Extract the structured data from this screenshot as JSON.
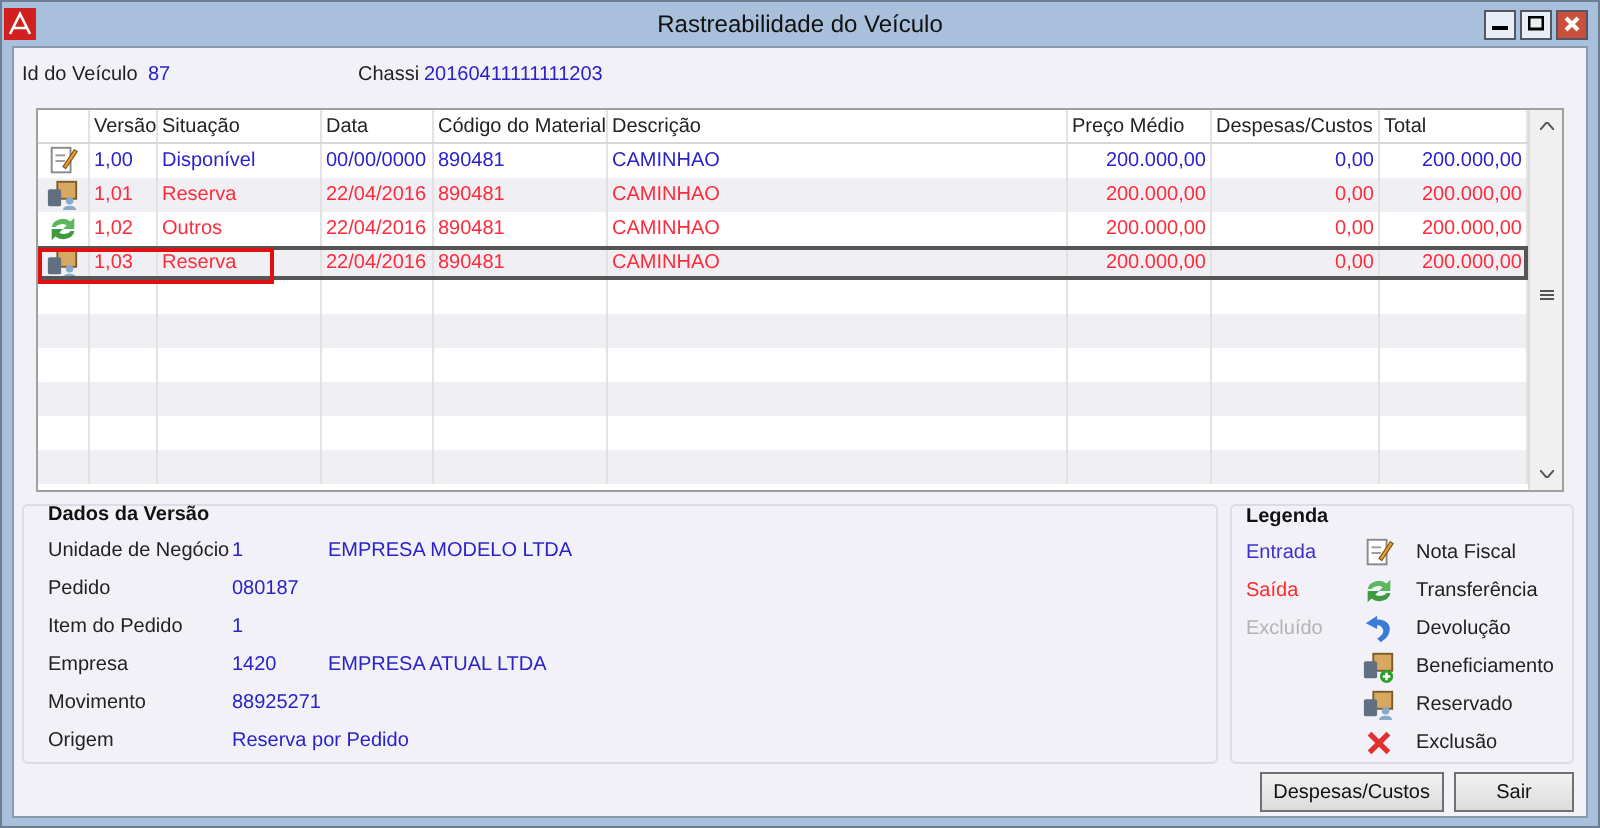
{
  "window": {
    "title": "Rastreabilidade do Veículo"
  },
  "header": {
    "vehicle_id_label": "Id do Veículo",
    "vehicle_id": "87",
    "chassis_label": "Chassi",
    "chassis": "20160411111111203"
  },
  "table": {
    "columns": [
      "Versão",
      "Situação",
      "Data",
      "Código do Material",
      "Descrição",
      "Preço Médio",
      "Despesas/Custos",
      "Total"
    ],
    "rows": [
      {
        "kind": "nota",
        "color": "#2b22c8",
        "selected": false,
        "highlighted": false,
        "cells": [
          "1,00",
          "Disponível",
          "00/00/0000",
          "890481",
          "CAMINHAO",
          "200.000,00",
          "0,00",
          "200.000,00"
        ]
      },
      {
        "kind": "reservado",
        "color": "#ff2a3a",
        "selected": false,
        "highlighted": false,
        "cells": [
          "1,01",
          "Reserva",
          "22/04/2016",
          "890481",
          "CAMINHAO",
          "200.000,00",
          "0,00",
          "200.000,00"
        ]
      },
      {
        "kind": "transferencia",
        "color": "#ff2a3a",
        "selected": false,
        "highlighted": false,
        "cells": [
          "1,02",
          "Outros",
          "22/04/2016",
          "890481",
          "CAMINHAO",
          "200.000,00",
          "0,00",
          "200.000,00"
        ]
      },
      {
        "kind": "reservado",
        "color": "#ff2a3a",
        "selected": true,
        "highlighted": true,
        "cells": [
          "1,03",
          "Reserva",
          "22/04/2016",
          "890481",
          "CAMINHAO",
          "200.000,00",
          "0,00",
          "200.000,00"
        ]
      }
    ]
  },
  "version_data": {
    "title": "Dados da Versão",
    "fields": [
      {
        "label": "Unidade de Negócio",
        "value": "1",
        "detail": "EMPRESA MODELO LTDA"
      },
      {
        "label": "Pedido",
        "value": "080187"
      },
      {
        "label": "Item do Pedido",
        "value": "1"
      },
      {
        "label": "Empresa",
        "value": "1420",
        "detail": "EMPRESA ATUAL LTDA"
      },
      {
        "label": "Movimento",
        "value": "88925271"
      },
      {
        "label": "Origem",
        "value": "Reserva por Pedido"
      }
    ]
  },
  "legend": {
    "title": "Legenda",
    "colors": [
      {
        "label": "Entrada",
        "color": "#3a2fd0"
      },
      {
        "label": "Saída",
        "color": "#ff2a2a"
      },
      {
        "label": "Excluído",
        "color": "#b4b4b4"
      }
    ],
    "icons": [
      {
        "kind": "nota",
        "label": "Nota Fiscal"
      },
      {
        "kind": "transferencia",
        "label": "Transferência"
      },
      {
        "kind": "devolucao",
        "label": "Devolução"
      },
      {
        "kind": "beneficiamento",
        "label": "Beneficiamento"
      },
      {
        "kind": "reservado",
        "label": "Reservado"
      },
      {
        "kind": "exclusao",
        "label": "Exclusão"
      }
    ]
  },
  "buttons": [
    "Despesas/Custos",
    "Sair"
  ]
}
